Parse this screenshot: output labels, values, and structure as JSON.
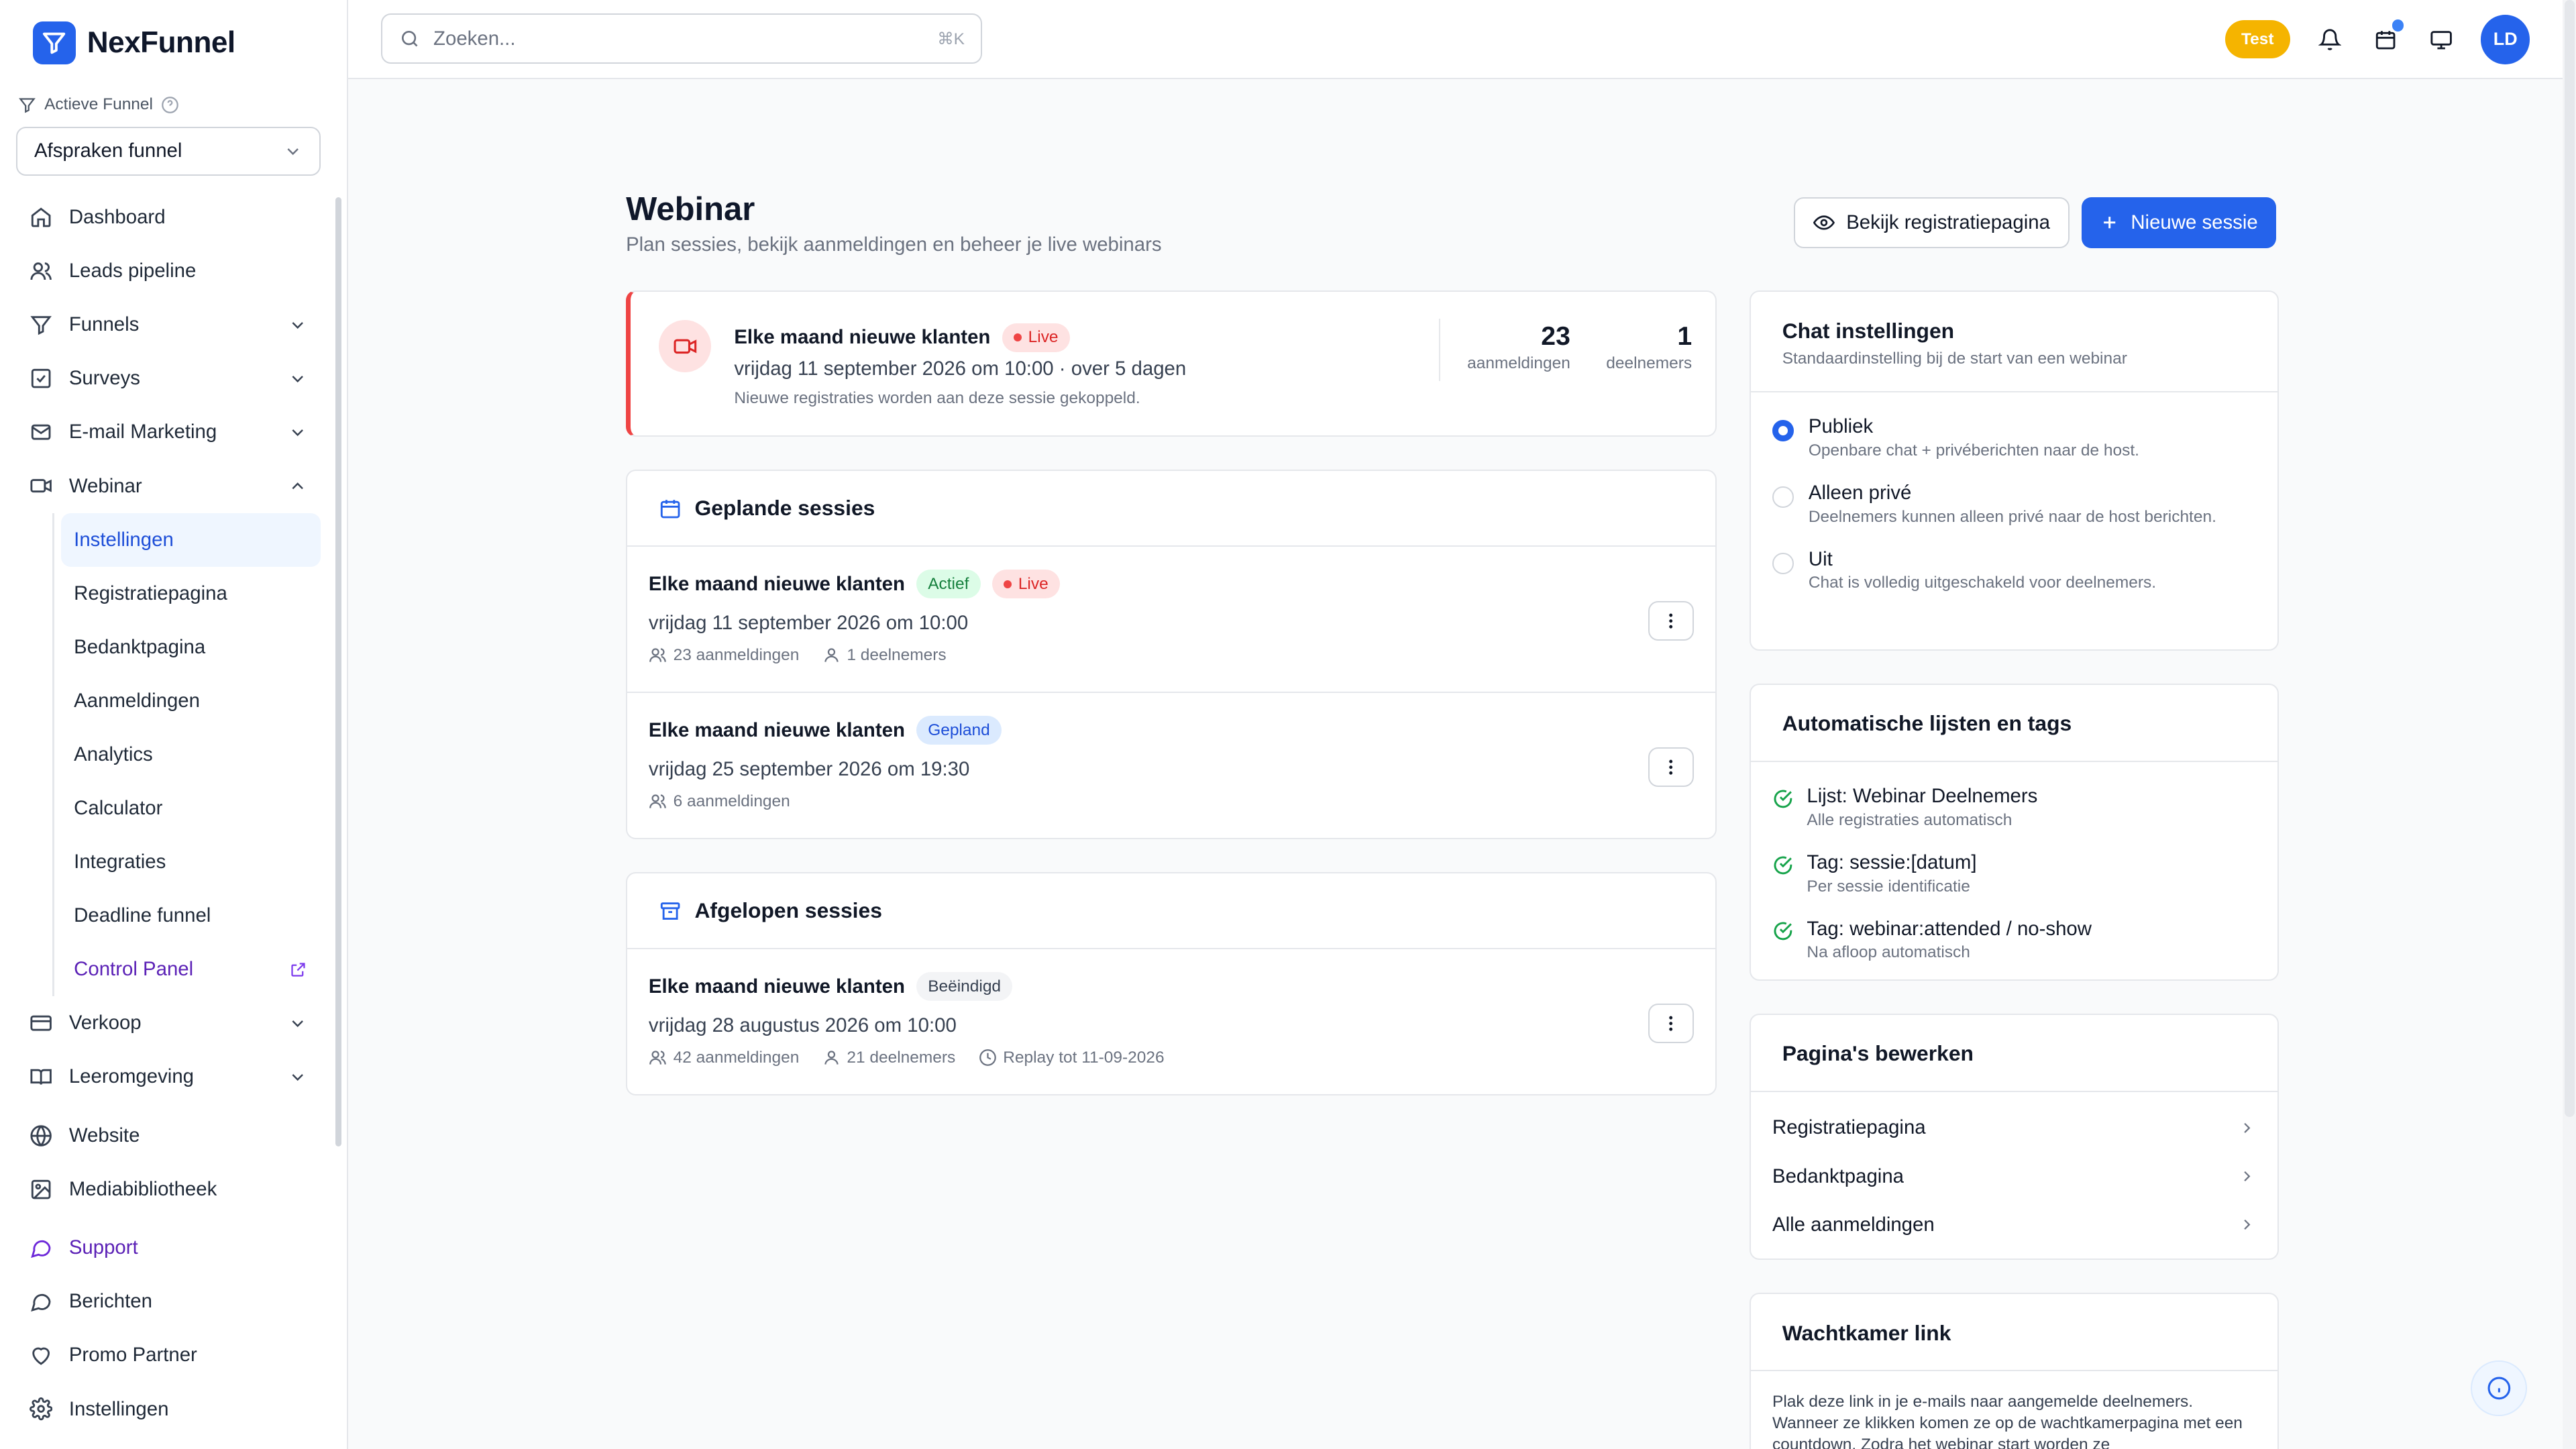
{
  "app": {
    "name": "NexFunnel"
  },
  "sidebar": {
    "active_funnel_label": "Actieve Funnel",
    "funnel_select_value": "Afspraken funnel",
    "items": [
      {
        "label": "Dashboard",
        "icon": "home-icon"
      },
      {
        "label": "Leads pipeline",
        "icon": "users-icon"
      },
      {
        "label": "Funnels",
        "icon": "filter-icon"
      },
      {
        "label": "Surveys",
        "icon": "checkbox-icon"
      },
      {
        "label": "E-mail Marketing",
        "icon": "mail-icon"
      },
      {
        "label": "Webinar",
        "icon": "video-icon"
      }
    ],
    "webinar_sub": [
      {
        "label": "Instellingen"
      },
      {
        "label": "Registratiepagina"
      },
      {
        "label": "Bedanktpagina"
      },
      {
        "label": "Aanmeldingen"
      },
      {
        "label": "Analytics"
      },
      {
        "label": "Calculator"
      },
      {
        "label": "Integraties"
      },
      {
        "label": "Deadline funnel"
      },
      {
        "label": "Control Panel"
      }
    ],
    "items2": [
      {
        "label": "Verkoop",
        "icon": "card-icon"
      },
      {
        "label": "Leeromgeving",
        "icon": "book-icon"
      },
      {
        "label": "Website",
        "icon": "globe-icon"
      },
      {
        "label": "Mediabibliotheek",
        "icon": "image-icon"
      },
      {
        "label": "Support",
        "icon": "chat-icon"
      },
      {
        "label": "Berichten",
        "icon": "message-icon"
      },
      {
        "label": "Promo Partner",
        "icon": "heart-icon"
      },
      {
        "label": "Instellingen",
        "icon": "gear-icon"
      }
    ]
  },
  "topbar": {
    "search_placeholder": "Zoeken...",
    "search_shortcut": "⌘K",
    "test_badge": "Test",
    "avatar_initials": "LD"
  },
  "page": {
    "title": "Webinar",
    "subtitle": "Plan sessies, bekijk aanmeldingen en beheer je live webinars",
    "view_registration_button": "Bekijk registratiepagina",
    "new_session_button": "Nieuwe sessie"
  },
  "live_session": {
    "title": "Elke maand nieuwe klanten",
    "badge": "Live",
    "date": "vrijdag 11 september 2026 om 10:00 · over 5 dagen",
    "note": "Nieuwe registraties worden aan deze sessie gekoppeld.",
    "registrations": "23",
    "registrations_label": "aanmeldingen",
    "participants": "1",
    "participants_label": "deelnemers"
  },
  "planned": {
    "heading": "Geplande sessies",
    "sessions": [
      {
        "title": "Elke maand nieuwe klanten",
        "badge1": "Actief",
        "badge2": "Live",
        "date": "vrijdag 11 september 2026 om 10:00",
        "registrations": "23 aanmeldingen",
        "participants": "1 deelnemers"
      },
      {
        "title": "Elke maand nieuwe klanten",
        "badge1": "Gepland",
        "date": "vrijdag 25 september 2026 om 19:30",
        "registrations": "6 aanmeldingen"
      }
    ]
  },
  "past": {
    "heading": "Afgelopen sessies",
    "sessions": [
      {
        "title": "Elke maand nieuwe klanten",
        "badge1": "Beëindigd",
        "date": "vrijdag 28 augustus 2026 om 10:00",
        "registrations": "42 aanmeldingen",
        "participants": "21 deelnemers",
        "replay": "Replay tot 11-09-2026"
      }
    ]
  },
  "chat_settings": {
    "title": "Chat instellingen",
    "subtitle": "Standaardinstelling bij de start van een webinar",
    "selected": "Publiek",
    "options": [
      {
        "label": "Publiek",
        "desc": "Openbare chat + privéberichten naar de host."
      },
      {
        "label": "Alleen privé",
        "desc": "Deelnemers kunnen alleen privé naar de host berichten."
      },
      {
        "label": "Uit",
        "desc": "Chat is volledig uitgeschakeld voor deelnemers."
      }
    ]
  },
  "auto_lists": {
    "title": "Automatische lijsten en tags",
    "items": [
      {
        "label": "Lijst: Webinar Deelnemers",
        "desc": "Alle registraties automatisch"
      },
      {
        "label": "Tag: sessie:[datum]",
        "desc": "Per sessie identificatie"
      },
      {
        "label": "Tag: webinar:attended / no-show",
        "desc": "Na afloop automatisch"
      }
    ]
  },
  "edit_pages": {
    "title": "Pagina's bewerken",
    "links": [
      "Registratiepagina",
      "Bedanktpagina",
      "Alle aanmeldingen"
    ]
  },
  "waiting_room": {
    "title": "Wachtkamer link",
    "text": "Plak deze link in je e-mails naar aangemelde deelnemers. Wanneer ze klikken komen ze op de wachtkamerpagina met een countdown. Zodra het webinar start worden ze"
  },
  "colors": {
    "primary": "#2563eb",
    "live": "#ef4444",
    "success": "#16a34a",
    "test": "#f5b400"
  }
}
